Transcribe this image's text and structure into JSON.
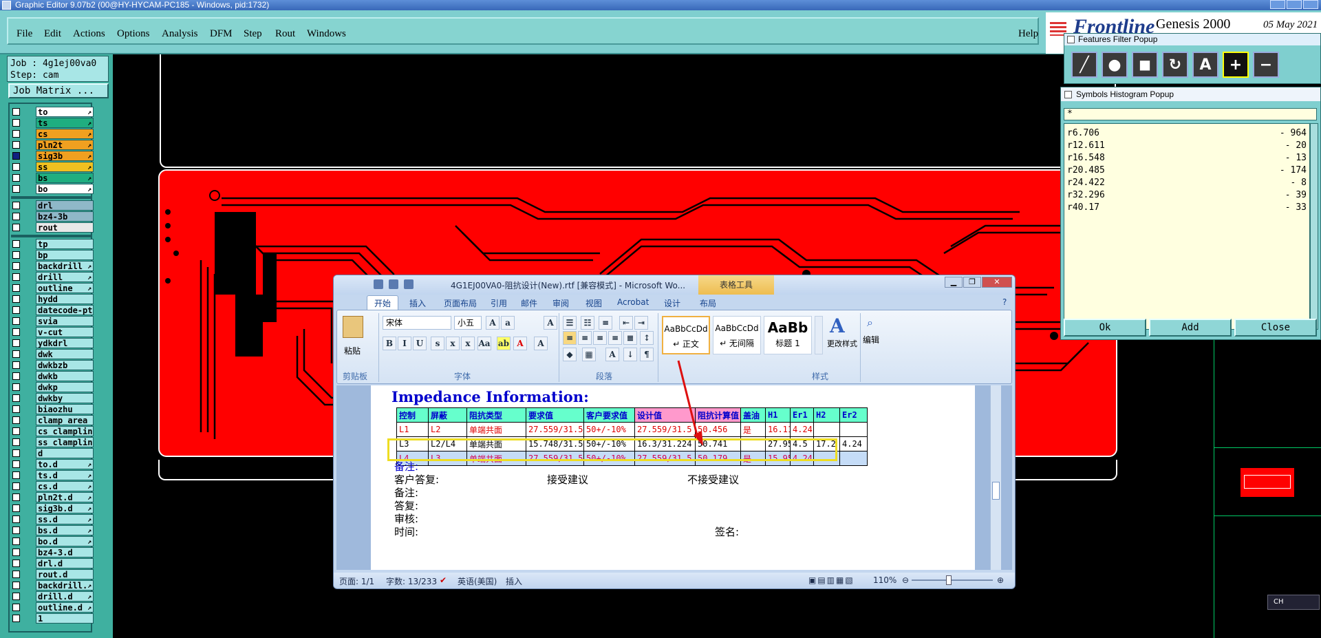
{
  "window_title": "Graphic Editor 9.07b2 (00@HY-HYCAM-PC185 - Windows, pid:1732)",
  "menu": {
    "file": "File",
    "edit": "Edit",
    "actions": "Actions",
    "options": "Options",
    "analysis": "Analysis",
    "dfm": "DFM",
    "step": "Step",
    "rout": "Rout",
    "windows": "Windows",
    "help": "Help"
  },
  "brand": {
    "logo": "Frontline",
    "product": "Genesis 2000",
    "date": "05 May 2021"
  },
  "job": {
    "job_line": "Job : 4g1ej00va0",
    "step_line": "Step: cam",
    "matrix_button": "Job Matrix ..."
  },
  "layers_board": [
    {
      "name": "to",
      "color": "#ffffff",
      "flag": "↗",
      "checked": false
    },
    {
      "name": "ts",
      "color": "#1fae80",
      "flag": "↗",
      "checked": false
    },
    {
      "name": "cs",
      "color": "#f0a020",
      "flag": "↗",
      "checked": false
    },
    {
      "name": "pln2t",
      "color": "#f0a020",
      "flag": "↗",
      "checked": false
    },
    {
      "name": "sig3b",
      "color": "#f0a020",
      "flag": "↗",
      "checked": true
    },
    {
      "name": "ss",
      "color": "#f0c020",
      "flag": "↗",
      "checked": false
    },
    {
      "name": "bs",
      "color": "#1fae80",
      "flag": "↗",
      "checked": false
    },
    {
      "name": "bo",
      "color": "#ffffff",
      "flag": "↗",
      "checked": false
    }
  ],
  "layers_drill": [
    {
      "name": "drl",
      "color": "#8fb8c8",
      "flag": "",
      "checked": false
    },
    {
      "name": "bz4-3b",
      "color": "#8fb8c8",
      "flag": "",
      "checked": false
    },
    {
      "name": "rout",
      "color": "#e8e8e8",
      "flag": "",
      "checked": false
    }
  ],
  "layers_misc": [
    {
      "name": "tp",
      "flag": ""
    },
    {
      "name": "bp",
      "flag": ""
    },
    {
      "name": "backdrill",
      "flag": "↗"
    },
    {
      "name": "drill",
      "flag": "↗"
    },
    {
      "name": "outline",
      "flag": "↗"
    },
    {
      "name": "hydd",
      "flag": ""
    },
    {
      "name": "datecode-pt",
      "flag": ""
    },
    {
      "name": "svia",
      "flag": ""
    },
    {
      "name": "v-cut",
      "flag": ""
    },
    {
      "name": "ydkdrl",
      "flag": ""
    },
    {
      "name": "dwk",
      "flag": ""
    },
    {
      "name": "dwkbzb",
      "flag": ""
    },
    {
      "name": "dwkb",
      "flag": ""
    },
    {
      "name": "dwkp",
      "flag": ""
    },
    {
      "name": "dwkby",
      "flag": ""
    },
    {
      "name": "biaozhu",
      "flag": ""
    },
    {
      "name": "clamp_area",
      "flag": ""
    },
    {
      "name": "cs_clampline",
      "flag": ""
    },
    {
      "name": "ss_clampline",
      "flag": ""
    },
    {
      "name": "d",
      "flag": ""
    },
    {
      "name": "to.d",
      "flag": "↗"
    },
    {
      "name": "ts.d",
      "flag": "↗"
    },
    {
      "name": "cs.d",
      "flag": "↗"
    },
    {
      "name": "pln2t.d",
      "flag": "↗"
    },
    {
      "name": "sig3b.d",
      "flag": "↗"
    },
    {
      "name": "ss.d",
      "flag": "↗"
    },
    {
      "name": "bs.d",
      "flag": "↗"
    },
    {
      "name": "bo.d",
      "flag": "↗"
    },
    {
      "name": "bz4-3.d",
      "flag": ""
    },
    {
      "name": "drl.d",
      "flag": ""
    },
    {
      "name": "rout.d",
      "flag": ""
    },
    {
      "name": "backdrill.",
      "flag": "↗"
    },
    {
      "name": "drill.d",
      "flag": "↗"
    },
    {
      "name": "outline.d",
      "flag": "↗"
    },
    {
      "name": "1",
      "flag": ""
    }
  ],
  "features_filter": {
    "title": "Features Filter Popup",
    "tools": [
      "line-icon",
      "pad-icon",
      "surface-icon",
      "arc-icon",
      "text-icon",
      "positive-icon",
      "negative-icon"
    ]
  },
  "symbols_histogram": {
    "title": "Symbols Histogram Popup",
    "filter": "*",
    "rows": [
      {
        "symbol": "r6.706",
        "count": "- 964"
      },
      {
        "symbol": "r12.611",
        "count": "- 20"
      },
      {
        "symbol": "r16.548",
        "count": "- 13"
      },
      {
        "symbol": "r20.485",
        "count": "- 174"
      },
      {
        "symbol": "r24.422",
        "count": "- 8"
      },
      {
        "symbol": "r32.296",
        "count": "- 39"
      },
      {
        "symbol": "r40.17",
        "count": "- 33"
      }
    ],
    "ok": "Ok",
    "add": "Add",
    "close": "Close"
  },
  "word": {
    "title": "4G1EJ00VA0-阻抗设计(New).rtf [兼容模式] - Microsoft Wo...",
    "context_tab": "表格工具",
    "tabs": [
      "开始",
      "插入",
      "页面布局",
      "引用",
      "邮件",
      "审阅",
      "视图",
      "Acrobat",
      "设计",
      "布局"
    ],
    "font_name": "宋体",
    "font_size": "小五",
    "group_clipboard": "剪贴板",
    "paste": "粘贴",
    "group_font": "字体",
    "group_paragraph": "段落",
    "group_styles": "样式",
    "styles": [
      {
        "sample": "AaBbCcDd",
        "name": "↵ 正文"
      },
      {
        "sample": "AaBbCcDd",
        "name": "↵ 无间隔"
      },
      {
        "sample": "AaBb",
        "name": "标题 1"
      }
    ],
    "change_styles": "更改样式",
    "edit": "编辑",
    "heading": "Impedance Information:",
    "table_headers": [
      "控制",
      "屏蔽",
      "阻抗类型",
      "要求值",
      "客户要求值",
      "设计值",
      "阻抗计算值",
      "盖油",
      "H1",
      "Er1",
      "H2",
      "Er2"
    ],
    "table_rows": [
      [
        "L1",
        "L2",
        "单端共面",
        "27.559/31.5",
        "50+/-10%",
        "27.559/31.5",
        "50.456",
        "是",
        "16.111",
        "4.24",
        "",
        ""
      ],
      [
        "L3",
        "L2/L4",
        "单端共面",
        "15.748/31.5",
        "50+/-10%",
        "16.3/31.224",
        "50.741",
        "",
        "27.95",
        "4.5",
        "17.2",
        "4.24"
      ],
      [
        "L4",
        "L3",
        "单端共面",
        "27.559/31.5",
        "50+/-10%",
        "27.559/31.5",
        "50.179",
        "是",
        "15.95",
        "4.24",
        "",
        ""
      ]
    ],
    "notes_label": "备注:",
    "customer_reply": "客户答复:",
    "accept": "接受建议",
    "reject": "不接受建议",
    "notes2": "备注:",
    "reply": "答复:",
    "review": "审核:",
    "time": "时间:",
    "signature": "签名:",
    "status_page": "页面: 1/1",
    "status_words": "字数: 13/233",
    "status_lang": "英语(美国)",
    "status_mode": "插入",
    "zoom": "110%"
  },
  "ime": "CH"
}
